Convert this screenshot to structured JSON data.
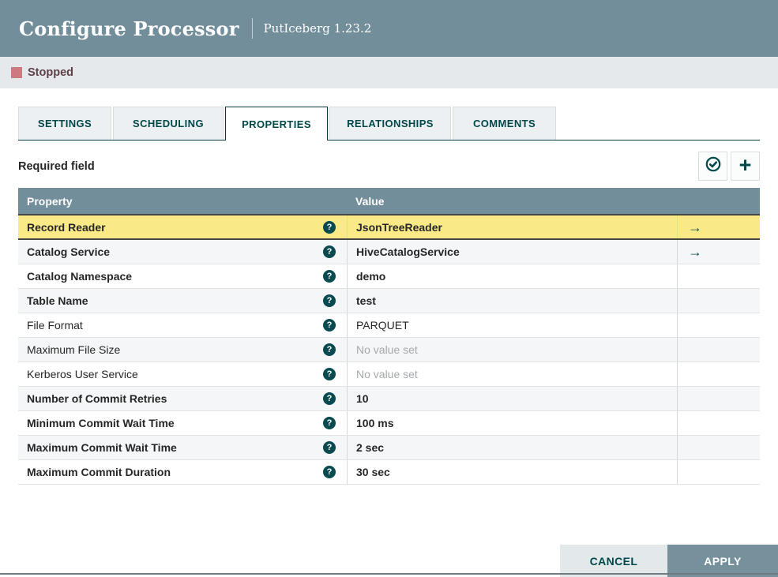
{
  "dialog": {
    "title": "Configure Processor",
    "subtitle": "PutIceberg 1.23.2"
  },
  "status": {
    "label": "Stopped"
  },
  "tabs": [
    {
      "label": "SETTINGS",
      "active": false
    },
    {
      "label": "SCHEDULING",
      "active": false
    },
    {
      "label": "PROPERTIES",
      "active": true
    },
    {
      "label": "RELATIONSHIPS",
      "active": false
    },
    {
      "label": "COMMENTS",
      "active": false
    }
  ],
  "toolbar": {
    "required_label": "Required field"
  },
  "icons": {
    "help": "?",
    "add": "+",
    "goto_arrow": "→",
    "verify": "check-circle"
  },
  "property_table": {
    "columns": {
      "property": "Property",
      "value": "Value"
    },
    "rows": [
      {
        "property": "Record Reader",
        "value": "JsonTreeReader",
        "required": true,
        "no_value": false,
        "value_bold": true,
        "highlighted": true,
        "goto_arrow": true
      },
      {
        "property": "Catalog Service",
        "value": "HiveCatalogService",
        "required": true,
        "no_value": false,
        "value_bold": true,
        "highlighted": false,
        "goto_arrow": true
      },
      {
        "property": "Catalog Namespace",
        "value": "demo",
        "required": true,
        "no_value": false,
        "value_bold": true,
        "highlighted": false,
        "goto_arrow": false
      },
      {
        "property": "Table Name",
        "value": "test",
        "required": true,
        "no_value": false,
        "value_bold": true,
        "highlighted": false,
        "goto_arrow": false
      },
      {
        "property": "File Format",
        "value": "PARQUET",
        "required": false,
        "no_value": false,
        "value_bold": false,
        "highlighted": false,
        "goto_arrow": false
      },
      {
        "property": "Maximum File Size",
        "value": "No value set",
        "required": false,
        "no_value": true,
        "value_bold": false,
        "highlighted": false,
        "goto_arrow": false
      },
      {
        "property": "Kerberos User Service",
        "value": "No value set",
        "required": false,
        "no_value": true,
        "value_bold": false,
        "highlighted": false,
        "goto_arrow": false
      },
      {
        "property": "Number of Commit Retries",
        "value": "10",
        "required": true,
        "no_value": false,
        "value_bold": true,
        "highlighted": false,
        "goto_arrow": false
      },
      {
        "property": "Minimum Commit Wait Time",
        "value": "100 ms",
        "required": true,
        "no_value": false,
        "value_bold": true,
        "highlighted": false,
        "goto_arrow": false
      },
      {
        "property": "Maximum Commit Wait Time",
        "value": "2 sec",
        "required": true,
        "no_value": false,
        "value_bold": true,
        "highlighted": false,
        "goto_arrow": false
      },
      {
        "property": "Maximum Commit Duration",
        "value": "30 sec",
        "required": true,
        "no_value": false,
        "value_bold": true,
        "highlighted": false,
        "goto_arrow": false
      }
    ]
  },
  "footer": {
    "cancel_label": "CANCEL",
    "apply_label": "APPLY"
  },
  "colors": {
    "header_bg": "#728E9B",
    "accent_teal": "#004849",
    "status_bar_bg": "#E5E9EC",
    "stopped_icon": "#CE7980",
    "stopped_text": "#5E4048",
    "highlight_row": "#F9EA87",
    "table_header_bg": "#728E9B",
    "alt_row_bg": "#F4F6F7",
    "muted_value": "#A5A8AB",
    "cancel_button_bg": "#E3E8EB",
    "apply_button_bg": "#76909C"
  }
}
